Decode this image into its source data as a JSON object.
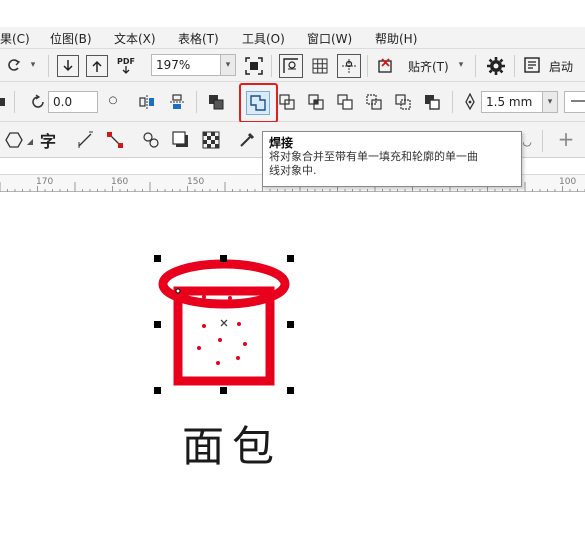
{
  "menubar": {
    "items": [
      {
        "label": "果(C)"
      },
      {
        "label": "位图(B)"
      },
      {
        "label": "文本(X)"
      },
      {
        "label": "表格(T)"
      },
      {
        "label": "工具(O)"
      },
      {
        "label": "窗口(W)"
      },
      {
        "label": "帮助(H)"
      }
    ]
  },
  "toolbar1": {
    "zoom_value": "197%",
    "snap_label": "贴齐(T)",
    "launch_label": "启动",
    "pdf_label": "PDF"
  },
  "toolbar2": {
    "rotation_value": "0.0",
    "outline_width": "1.5 mm"
  },
  "toolbar3": {
    "text_tool_glyph": "字"
  },
  "tooltip": {
    "title": "焊接",
    "body_line1": "将对象合并至带有单一填充和轮廓的单一曲",
    "body_line2": "线对象中."
  },
  "ruler": {
    "ticks": [
      "170",
      "160",
      "150",
      "100"
    ]
  },
  "canvas": {
    "object_label": "面包",
    "accent_color": "#e8001c"
  }
}
